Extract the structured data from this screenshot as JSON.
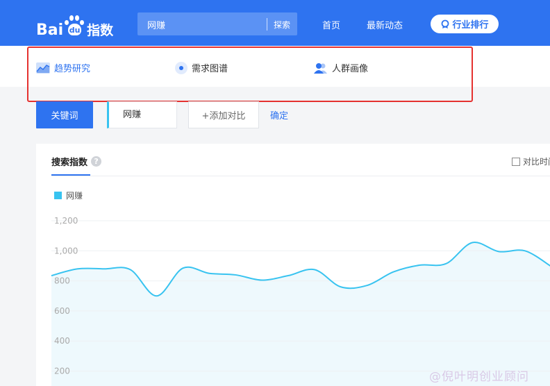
{
  "header": {
    "logo_left": "Bai",
    "logo_paw": "du",
    "logo_right": "指数",
    "search_value": "网赚",
    "search_button": "探索",
    "nav_home": "首页",
    "nav_news": "最新动态",
    "rank_button": "行业排行"
  },
  "tabs": {
    "trend": "趋势研究",
    "demand": "需求图谱",
    "crowd": "人群画像"
  },
  "keyword_row": {
    "keyword_button": "关键词",
    "keyword_value": "网赚",
    "add_compare": "+添加对比",
    "confirm": "确定"
  },
  "card": {
    "tab_label": "搜索指数",
    "help": "?",
    "compare_time": "对比时间"
  },
  "watermark": "@倪叶明创业顾问",
  "colors": {
    "brand_blue": "#2e73f0",
    "series_line": "#38c3f0",
    "highlight_frame": "#e5312f"
  },
  "chart_data": {
    "type": "area",
    "yticks": [
      "1,200",
      "1,000",
      "800",
      "600",
      "400",
      "200"
    ],
    "ylim": [
      0,
      1300
    ],
    "series": [
      {
        "name": "网赚",
        "color": "#38c3f0",
        "values": [
          835,
          880,
          880,
          875,
          700,
          885,
          850,
          840,
          805,
          835,
          875,
          760,
          770,
          860,
          905,
          915,
          1055,
          995,
          1000,
          895
        ]
      }
    ]
  }
}
